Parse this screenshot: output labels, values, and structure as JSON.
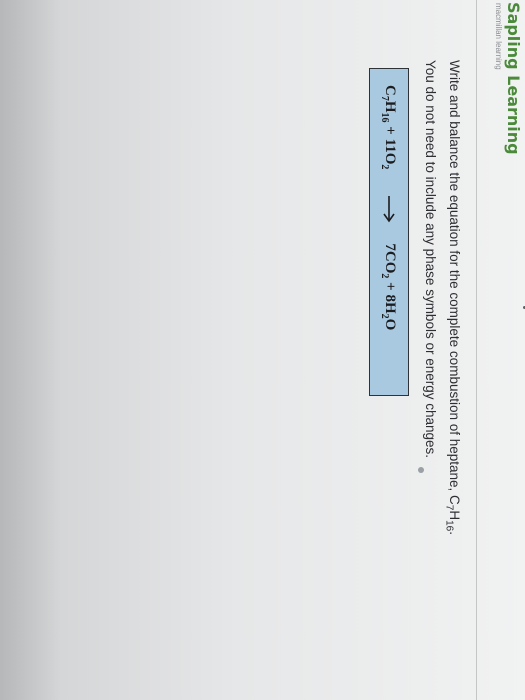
{
  "brand": {
    "name": "Sapling Learning",
    "subtitle": "macmillan learning"
  },
  "question": {
    "line1": "Write and balance the equation for the complete combustion of heptane, C",
    "line1_sub": "7",
    "line1_mid": "H",
    "line1_sub2": "16",
    "line1_end": ".",
    "line2": "You do not need to include any phase symbols or energy changes."
  },
  "answer": {
    "reactant_c": "C",
    "reactant_c_sub": "7",
    "reactant_h": "H",
    "reactant_h_sub": "16",
    "reactant_rest": " + 11O",
    "reactant_o_sub": "2",
    "product_co": "7CO",
    "product_co_sub": "2",
    "product_h": " + 8H",
    "product_h_sub": "2",
    "product_o": "O"
  },
  "icons": {
    "arrow": "reaction-arrow-icon"
  },
  "colors": {
    "brand_green": "#4a8a3a",
    "answer_bg": "#a9c9e0"
  }
}
